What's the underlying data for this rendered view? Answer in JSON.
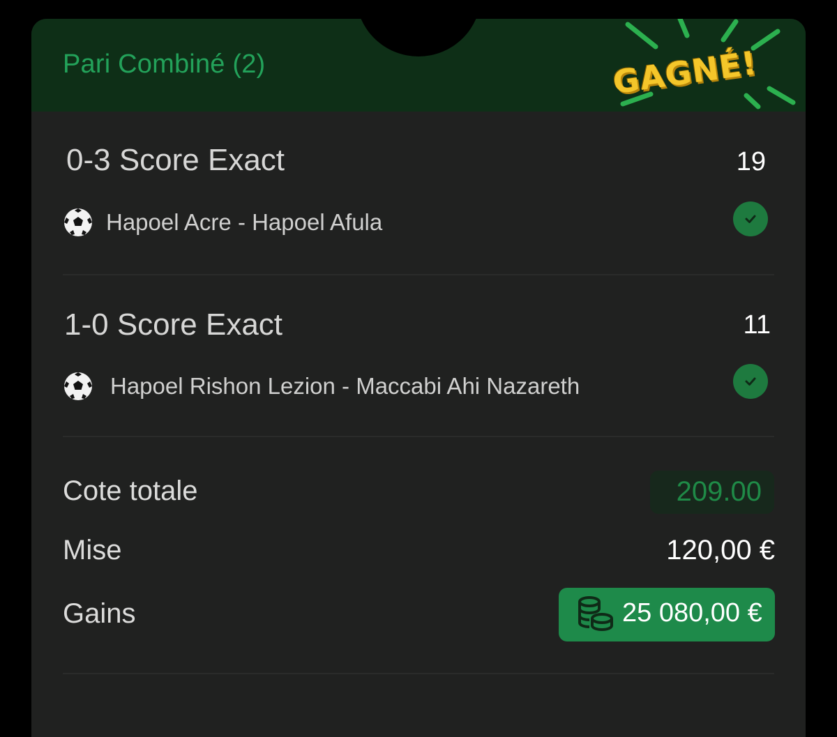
{
  "header": {
    "title": "Pari Combiné (2)",
    "status_badge": "GAGNÉ!"
  },
  "selections": [
    {
      "market": "0-3 Score Exact",
      "odds": "19",
      "match": "Hapoel Acre - Hapoel Afula",
      "sport_icon": "soccer-ball-icon",
      "status_icon": "check-icon"
    },
    {
      "market": "1-0 Score Exact",
      "odds": "11",
      "match": "Hapoel Rishon Lezion - Maccabi Ahi Nazareth",
      "sport_icon": "soccer-ball-icon",
      "status_icon": "check-icon"
    }
  ],
  "summary": {
    "total_odds_label": "Cote totale",
    "total_odds_value": "209.00",
    "stake_label": "Mise",
    "stake_value": "120,00 €",
    "winnings_label": "Gains",
    "winnings_value": "25 080,00 €",
    "winnings_icon": "coins-icon"
  },
  "colors": {
    "background": "#000000",
    "card": "#202120",
    "header": "#0e2f17",
    "accent_green": "#1e8a4a",
    "title_green": "#23a25a",
    "badge_yellow": "#f4c62a"
  }
}
